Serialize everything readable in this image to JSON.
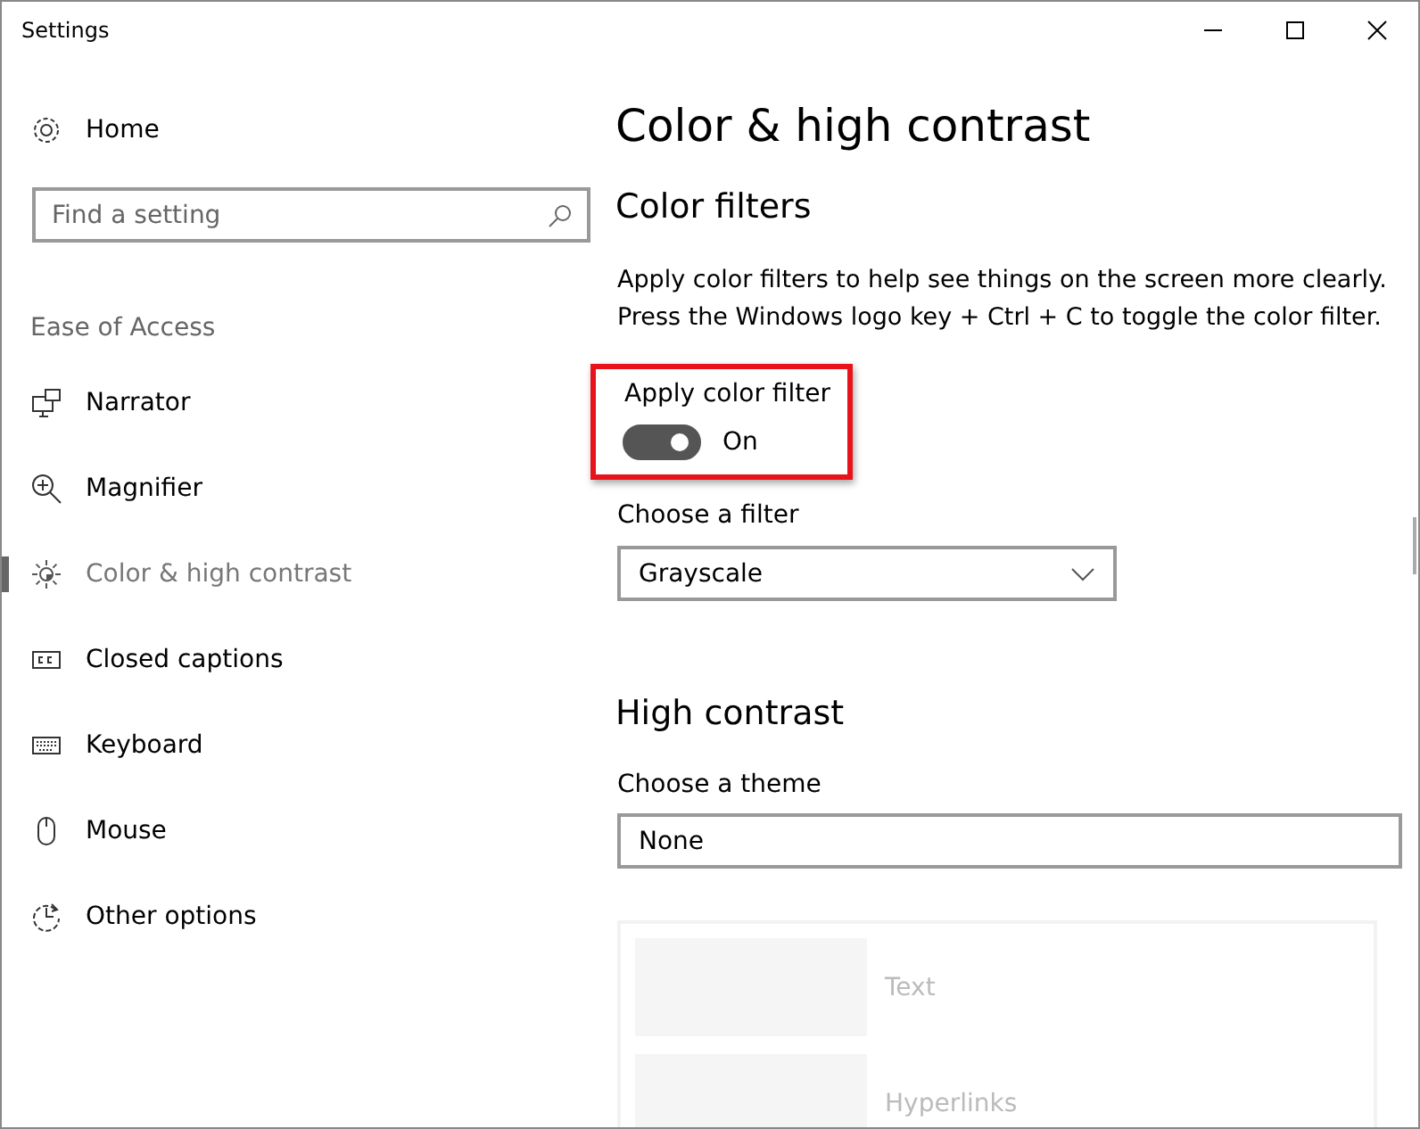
{
  "window": {
    "title": "Settings"
  },
  "sidebar": {
    "home": "Home",
    "search": {
      "placeholder": "Find a setting"
    },
    "section": "Ease of Access",
    "items": [
      {
        "label": "Narrator",
        "kind": "narrator",
        "selected": false
      },
      {
        "label": "Magnifier",
        "kind": "magnifier",
        "selected": false
      },
      {
        "label": "Color & high contrast",
        "kind": "color",
        "selected": true
      },
      {
        "label": "Closed captions",
        "kind": "captions",
        "selected": false
      },
      {
        "label": "Keyboard",
        "kind": "keyboard",
        "selected": false
      },
      {
        "label": "Mouse",
        "kind": "mouse",
        "selected": false
      },
      {
        "label": "Other options",
        "kind": "other",
        "selected": false
      }
    ]
  },
  "content": {
    "title": "Color & high contrast",
    "color_filters": {
      "heading": "Color filters",
      "description": [
        "Apply color filters to help see things on the screen more clearly.",
        "Press the Windows logo key + Ctrl + C to toggle the color filter."
      ],
      "toggle": {
        "label": "Apply color filter",
        "on": true,
        "state_text": "On",
        "highlighted": true
      },
      "filter": {
        "label": "Choose a filter",
        "value": "Grayscale"
      }
    },
    "high_contrast": {
      "heading": "High contrast",
      "theme": {
        "label": "Choose a theme",
        "value": "None"
      },
      "preview": [
        "Text",
        "Hyperlinks"
      ]
    }
  }
}
